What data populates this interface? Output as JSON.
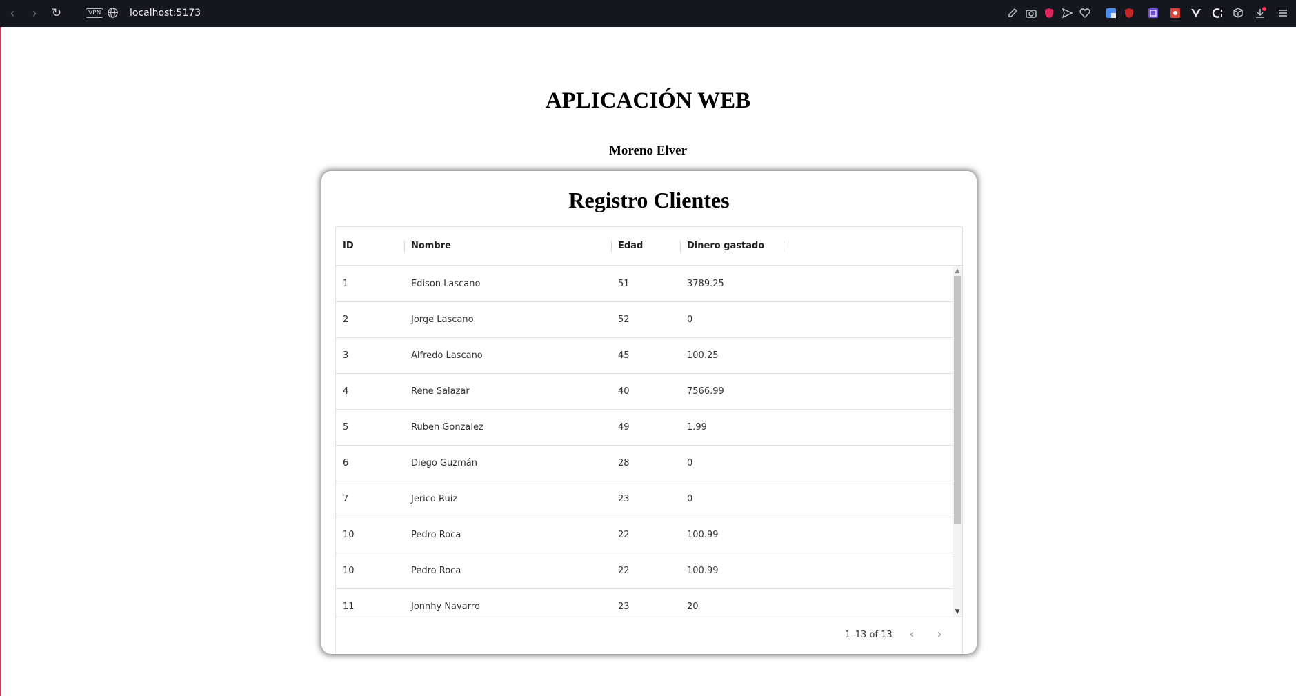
{
  "browser": {
    "url": "localhost:5173",
    "vpn_label": "VPN",
    "back_glyph": "‹",
    "forward_glyph": "›",
    "reload_glyph": "↻"
  },
  "page": {
    "title": "APLICACIÓN WEB",
    "author": "Moreno Elver"
  },
  "card": {
    "title": "Registro Clientes"
  },
  "table": {
    "columns": [
      "ID",
      "Nombre",
      "Edad",
      "Dinero gastado"
    ],
    "rows": [
      [
        "1",
        "Edison Lascano",
        "51",
        "3789.25"
      ],
      [
        "2",
        "Jorge Lascano",
        "52",
        "0"
      ],
      [
        "3",
        "Alfredo Lascano",
        "45",
        "100.25"
      ],
      [
        "4",
        "Rene Salazar",
        "40",
        "7566.99"
      ],
      [
        "5",
        "Ruben Gonzalez",
        "49",
        "1.99"
      ],
      [
        "6",
        "Diego Guzmán",
        "28",
        "0"
      ],
      [
        "7",
        "Jerico Ruiz",
        "23",
        "0"
      ],
      [
        "10",
        "Pedro Roca",
        "22",
        "100.99"
      ],
      [
        "10",
        "Pedro Roca",
        "22",
        "100.99"
      ],
      [
        "11",
        "Jonnhy Navarro",
        "23",
        "20"
      ]
    ],
    "pagination": "1–13 of 13",
    "prev_glyph": "‹",
    "next_glyph": "›",
    "scroll_up_glyph": "▲",
    "scroll_down_glyph": "▼"
  },
  "colors": {
    "chrome_bg": "#16161f",
    "accent": "#c63a58",
    "border": "#e0e0e0"
  }
}
